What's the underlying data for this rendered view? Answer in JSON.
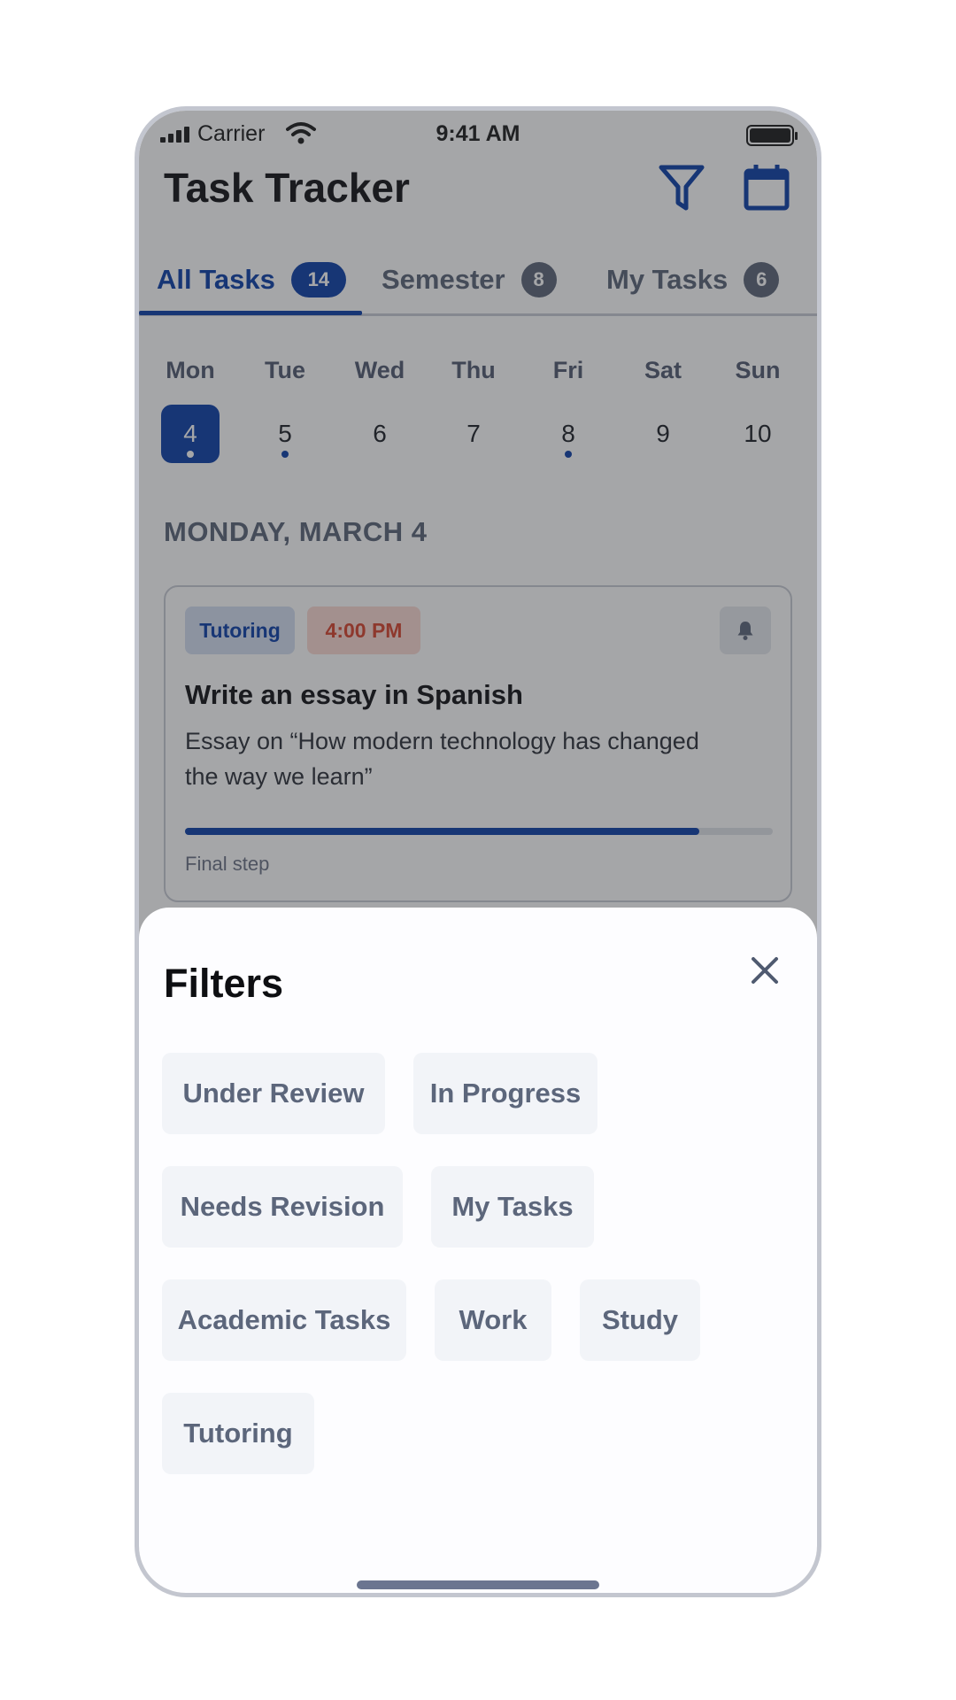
{
  "status_bar": {
    "carrier": "Carrier",
    "time": "9:41 AM",
    "icons": [
      "signal-icon",
      "wifi-icon",
      "battery-icon"
    ]
  },
  "header": {
    "title": "Task Tracker",
    "actions": [
      "filter-icon",
      "calendar-icon"
    ],
    "accent_color": "#0b3ea8"
  },
  "tabs": [
    {
      "label": "All Tasks",
      "count": "14",
      "active": true
    },
    {
      "label": "Semester",
      "count": "8",
      "active": false
    },
    {
      "label": "My Tasks",
      "count": "6",
      "active": false
    }
  ],
  "week": {
    "days": [
      {
        "name": "Mon",
        "num": "4",
        "selected": true,
        "has_dot": true
      },
      {
        "name": "Tue",
        "num": "5",
        "selected": false,
        "has_dot": true
      },
      {
        "name": "Wed",
        "num": "6",
        "selected": false,
        "has_dot": false
      },
      {
        "name": "Thu",
        "num": "7",
        "selected": false,
        "has_dot": false
      },
      {
        "name": "Fri",
        "num": "8",
        "selected": false,
        "has_dot": true
      },
      {
        "name": "Sat",
        "num": "9",
        "selected": false,
        "has_dot": false
      },
      {
        "name": "Sun",
        "num": "10",
        "selected": false,
        "has_dot": false
      }
    ]
  },
  "section_title": "MONDAY, MARCH 4",
  "task_card": {
    "category": "Tutoring",
    "time": "4:00 PM",
    "title": "Write an essay in Spanish",
    "description": "Essay on “How modern technology has changed the way we learn”",
    "progress_fraction": 0.875,
    "step_label": "Final step",
    "bell_icon": "bell-icon"
  },
  "filters_sheet": {
    "title": "Filters",
    "close_icon": "close-icon",
    "options": [
      "Under Review",
      "In Progress",
      "Needs Revision",
      "My Tasks",
      "Academic Tasks",
      "Work",
      "Study",
      "Tutoring"
    ]
  }
}
